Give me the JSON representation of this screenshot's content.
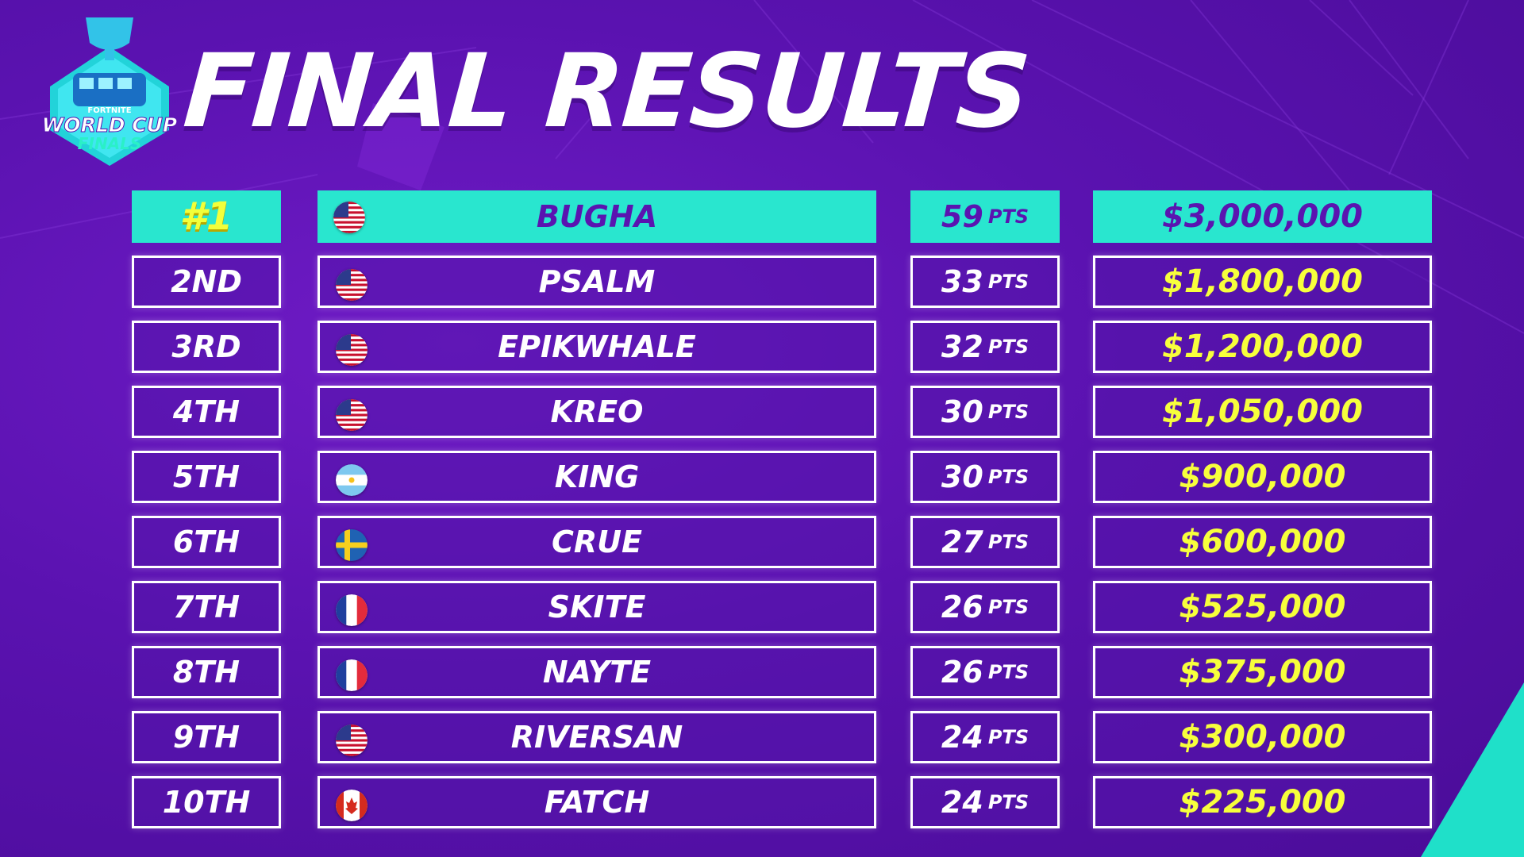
{
  "logo": {
    "brand": "FORTNITE",
    "line1": "WORLD CUP",
    "line2": "FINALS"
  },
  "title": "FINAL RESULTS",
  "pts_label": "PTS",
  "colors": {
    "background": "#5a12b0",
    "first_row": "#29e6cf",
    "prize": "#f7ff3c",
    "border": "#ffffff"
  },
  "results": [
    {
      "rank": "#1",
      "flag": "us-flag-icon",
      "player": "BUGHA",
      "points": "59",
      "prize": "$3,000,000"
    },
    {
      "rank": "2ND",
      "flag": "us-flag-icon",
      "player": "PSALM",
      "points": "33",
      "prize": "$1,800,000"
    },
    {
      "rank": "3RD",
      "flag": "us-flag-icon",
      "player": "EPIKWHALE",
      "points": "32",
      "prize": "$1,200,000"
    },
    {
      "rank": "4TH",
      "flag": "us-flag-icon",
      "player": "KREO",
      "points": "30",
      "prize": "$1,050,000"
    },
    {
      "rank": "5TH",
      "flag": "argentina-flag-icon",
      "player": "KING",
      "points": "30",
      "prize": "$900,000"
    },
    {
      "rank": "6TH",
      "flag": "sweden-flag-icon",
      "player": "CRUE",
      "points": "27",
      "prize": "$600,000"
    },
    {
      "rank": "7TH",
      "flag": "france-flag-icon",
      "player": "SKITE",
      "points": "26",
      "prize": "$525,000"
    },
    {
      "rank": "8TH",
      "flag": "france-flag-icon",
      "player": "NAYTE",
      "points": "26",
      "prize": "$375,000"
    },
    {
      "rank": "9TH",
      "flag": "us-flag-icon",
      "player": "RIVERSAN",
      "points": "24",
      "prize": "$300,000"
    },
    {
      "rank": "10TH",
      "flag": "canada-flag-icon",
      "player": "FATCH",
      "points": "24",
      "prize": "$225,000"
    }
  ]
}
